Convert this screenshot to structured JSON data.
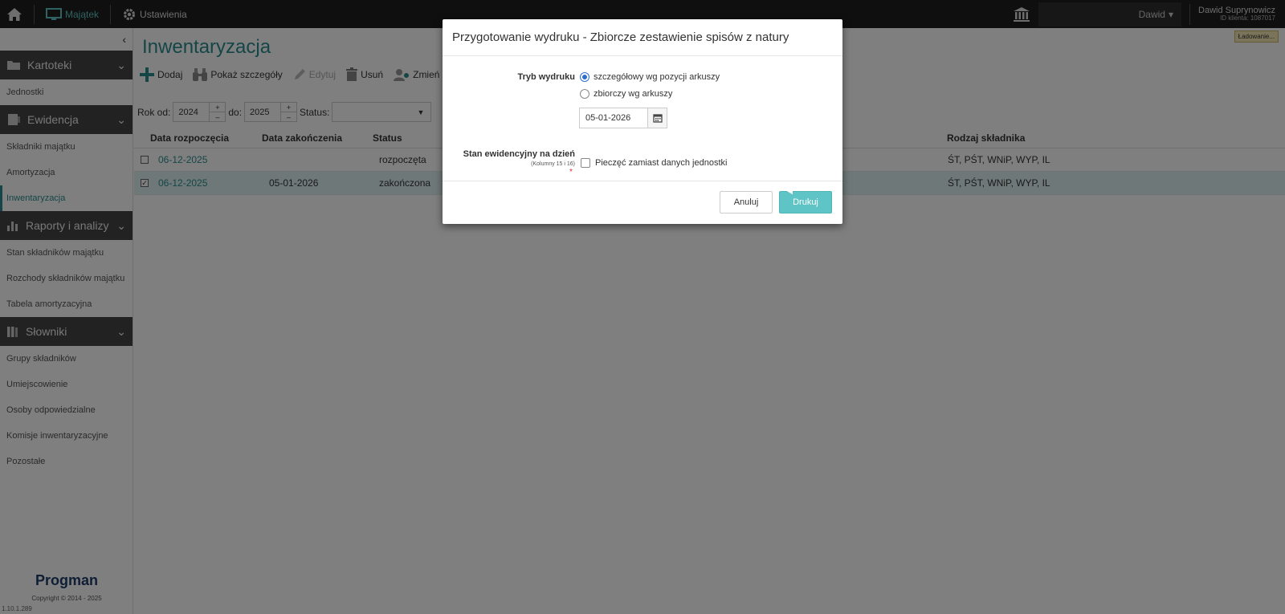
{
  "topbar": {
    "home_icon": "home-icon",
    "nav": [
      {
        "label": "Majątek",
        "icon": "monitor-icon",
        "active": true
      },
      {
        "label": "Ustawienia",
        "icon": "gear-icon",
        "active": false
      }
    ],
    "bank_icon": "bank-icon",
    "user_select": "Dawid",
    "user_name": "Dawid Suprynowicz",
    "client_id": "ID klienta: 1087017"
  },
  "sidebar": {
    "groups": [
      {
        "title": "Kartoteki",
        "icon": "folder-icon",
        "items": [
          "Jednostki"
        ]
      },
      {
        "title": "Ewidencja",
        "icon": "register-icon",
        "items": [
          "Składniki majątku",
          "Amortyzacja",
          "Inwentaryzacja"
        ]
      },
      {
        "title": "Raporty i analizy",
        "icon": "bar-chart-icon",
        "items": [
          "Stan składników majątku",
          "Rozchody składników majątku",
          "Tabela amortyzacyjna"
        ]
      },
      {
        "title": "Słowniki",
        "icon": "books-icon",
        "items": [
          "Grupy składników",
          "Umiejscowienie",
          "Osoby odpowiedzialne",
          "Komisje inwentaryzacyjne",
          "Pozostałe"
        ]
      }
    ],
    "active_item": "Inwentaryzacja",
    "brand": "Progman",
    "copyright": "Copyright © 2014 - 2025",
    "version": "1.10.1.289"
  },
  "main": {
    "title": "Inwentaryzacja",
    "loading": "Ładowanie...",
    "toolbar": {
      "add": "Dodaj",
      "details": "Pokaż szczegóły",
      "edit": "Edytuj",
      "delete": "Usuń",
      "change_status": "Zmień st"
    },
    "filters": {
      "year_from_label": "Rok od:",
      "year_from": "2024",
      "year_to_label": "do:",
      "year_to": "2025",
      "status_label": "Status:",
      "status_value": ""
    },
    "table": {
      "columns": [
        "Data rozpoczęcia",
        "Data zakończenia",
        "Status",
        "Rodzaj składnika"
      ],
      "rows": [
        {
          "checked": false,
          "start": "06-12-2025",
          "end": "",
          "status": "rozpoczęta",
          "kind": "ŚT, PŚT, WNiP, WYP, IL"
        },
        {
          "checked": true,
          "start": "06-12-2025",
          "end": "05-01-2026",
          "status": "zakończona",
          "kind": "ŚT, PŚT, WNiP, WYP, IL"
        }
      ]
    }
  },
  "modal": {
    "title": "Przygotowanie wydruku - Zbiorcze zestawienie spisów z natury",
    "print_mode_label": "Tryb wydruku",
    "options": [
      {
        "label": "szczegółowy wg pozycji arkuszy",
        "selected": true
      },
      {
        "label": "zbiorczy wg arkuszy",
        "selected": false
      }
    ],
    "date_label": "Stan ewidencyjny na dzień",
    "date_sublabel": "(Kolumny 15 i 16)",
    "required_mark": "*",
    "date_value": "05-01-2026",
    "stamp_label": "Pieczęć zamiast danych jednostki",
    "cancel": "Anuluj",
    "print": "Drukuj"
  }
}
